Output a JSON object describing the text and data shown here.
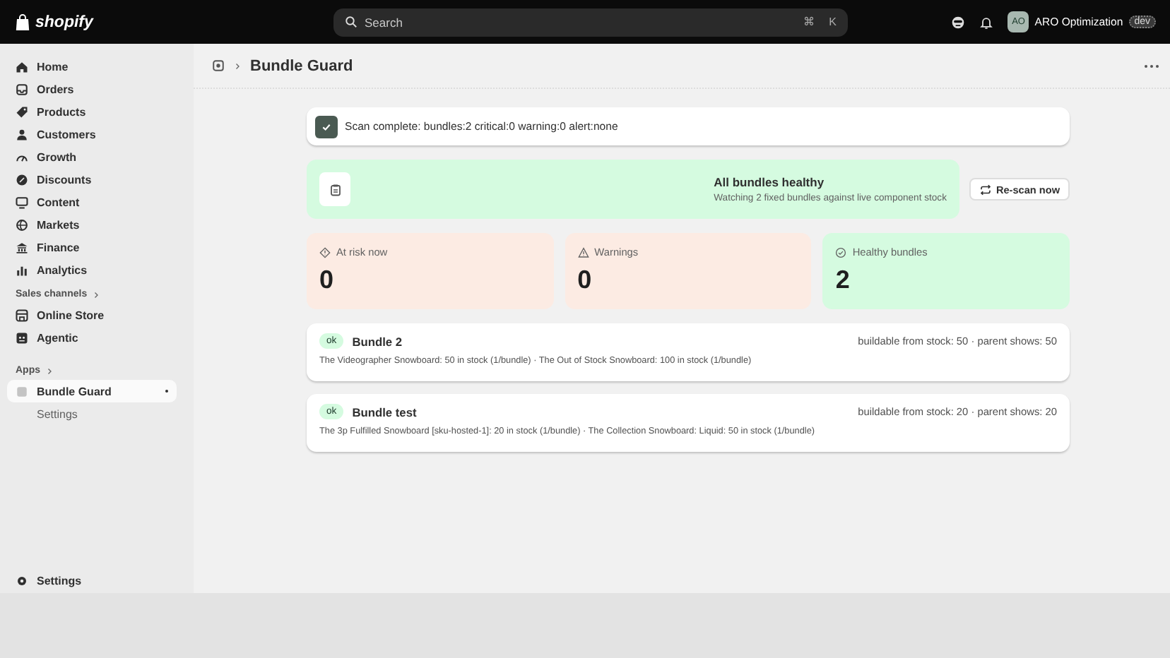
{
  "topbar": {
    "logo": "shopify",
    "search": {
      "placeholder": "Search",
      "shortcut": [
        "⌘",
        "K"
      ]
    },
    "store": {
      "initials": "AO",
      "name": "ARO Optimization",
      "badge": "dev"
    }
  },
  "sidebar": {
    "groups": [
      {
        "items": [
          {
            "label": "Home",
            "selected": false
          },
          {
            "label": "Orders",
            "selected": false
          },
          {
            "label": "Products",
            "selected": false
          },
          {
            "label": "Customers",
            "selected": false
          },
          {
            "label": "Growth",
            "selected": false
          },
          {
            "label": "Discounts",
            "selected": false
          },
          {
            "label": "Content",
            "selected": false
          },
          {
            "label": "Markets",
            "selected": false
          },
          {
            "label": "Finance",
            "selected": false
          },
          {
            "label": "Analytics",
            "selected": false
          }
        ]
      },
      {
        "heading": "Sales channels",
        "items": [
          {
            "label": "Online Store",
            "selected": false
          },
          {
            "label": "Agentic",
            "selected": false
          }
        ]
      },
      {
        "heading": "Apps",
        "items": [
          {
            "label": "Bundle Guard",
            "selected": true,
            "children": [
              {
                "label": "Settings",
                "selected": false
              }
            ]
          }
        ]
      }
    ],
    "footer": "Settings"
  },
  "page": {
    "title": "Bundle Guard",
    "scan_banner": "Scan complete: bundles:2 critical:0 warning:0 alert:none",
    "health": {
      "title": "All bundles healthy",
      "subtitle": "Watching 2 fixed bundles against live component stock",
      "button": "Re-scan now"
    },
    "stats": [
      {
        "kind": "risk",
        "label": "At risk now",
        "value": "0"
      },
      {
        "kind": "warning",
        "label": "Warnings",
        "value": "0"
      },
      {
        "kind": "healthy",
        "label": "Healthy bundles",
        "value": "2"
      }
    ],
    "bundles": [
      {
        "status": "ok",
        "name": "Bundle 2",
        "summary": "buildable from stock: 50 · parent shows: 50",
        "components": "The Videographer Snowboard: 50 in stock (1/bundle) · The Out of Stock Snowboard: 100 in stock (1/bundle)"
      },
      {
        "status": "ok",
        "name": "Bundle test",
        "summary": "buildable from stock: 20 · parent shows: 20",
        "components": "The 3p Fulfilled Snowboard [sku-hosted-1]: 20 in stock (1/bundle) · The Collection Snowboard: Liquid: 50 in stock (1/bundle)"
      }
    ]
  }
}
